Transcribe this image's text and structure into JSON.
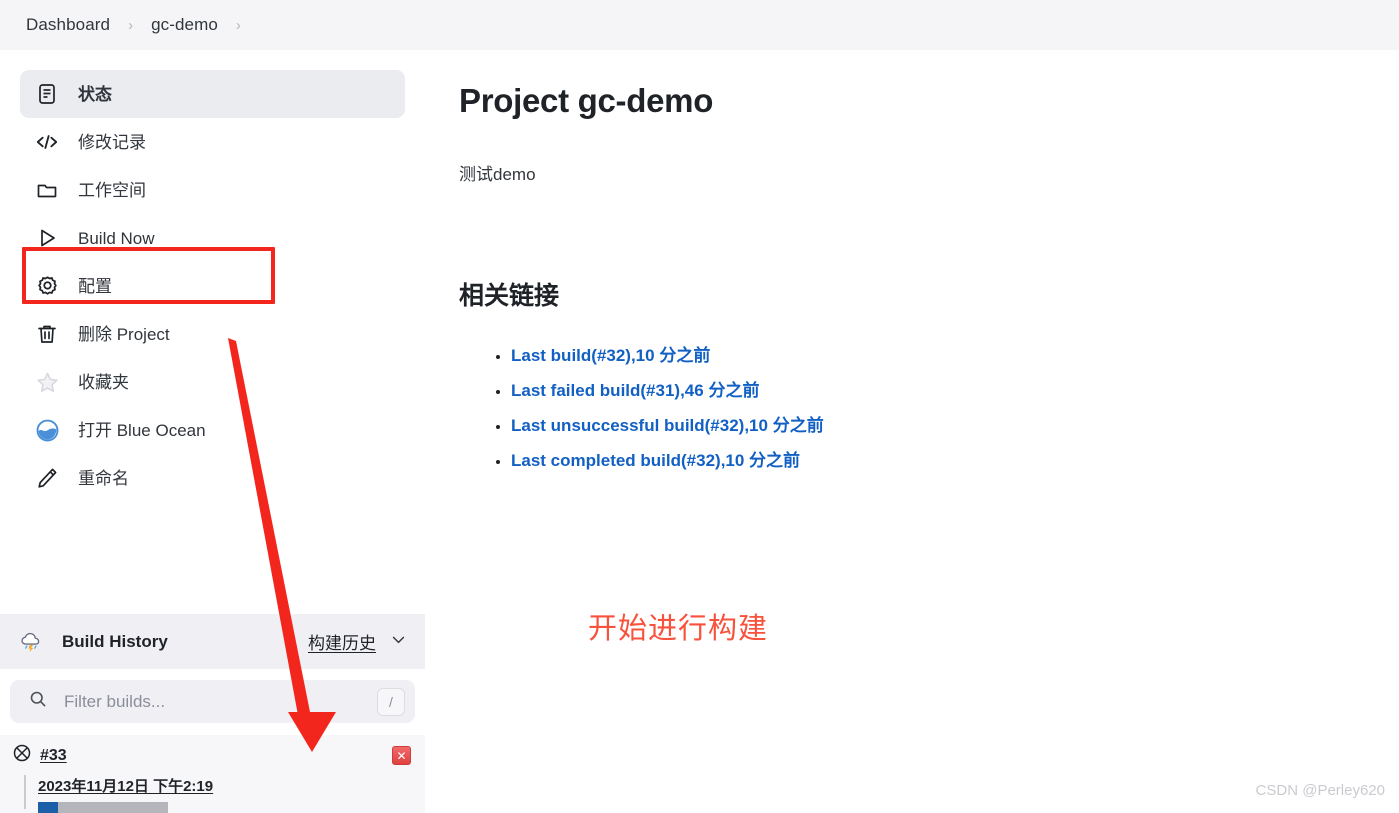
{
  "breadcrumb": {
    "items": [
      {
        "label": "Dashboard"
      },
      {
        "label": "gc-demo"
      }
    ],
    "separator": "›"
  },
  "sidebar": {
    "items": [
      {
        "label": "状态",
        "icon": "document-icon",
        "active": true
      },
      {
        "label": "修改记录",
        "icon": "code-icon",
        "active": false
      },
      {
        "label": "工作空间",
        "icon": "folder-icon",
        "active": false
      },
      {
        "label": "Build Now",
        "icon": "play-icon",
        "active": false
      },
      {
        "label": "配置",
        "icon": "gear-icon",
        "active": false
      },
      {
        "label": "删除 Project",
        "icon": "trash-icon",
        "active": false
      },
      {
        "label": "收藏夹",
        "icon": "star-icon",
        "active": false
      },
      {
        "label": "打开 Blue Ocean",
        "icon": "blue-ocean-icon",
        "active": false
      },
      {
        "label": "重命名",
        "icon": "pencil-icon",
        "active": false
      }
    ]
  },
  "build_history": {
    "title": "Build History",
    "title_cn": "构建历史",
    "weather_icon": "cloud-lightning-icon",
    "chevron_icon": "chevron-down-icon",
    "filter": {
      "placeholder": "Filter builds...",
      "value": "",
      "search_icon": "search-icon",
      "shortcut": "/"
    },
    "builds": [
      {
        "number": "#33",
        "status_icon": "aborted-icon",
        "date": "2023年11月12日 下午2:19",
        "progress_percent": 15,
        "stop_label": "✕"
      }
    ]
  },
  "main": {
    "title": "Project gc-demo",
    "description": "测试demo",
    "section_title": "相关链接",
    "links": [
      {
        "label": "Last build(#32),10 分之前"
      },
      {
        "label": "Last failed build(#31),46 分之前"
      },
      {
        "label": "Last unsuccessful build(#32),10 分之前"
      },
      {
        "label": "Last completed build(#32),10 分之前"
      }
    ]
  },
  "annotations": {
    "callout_text": "开始进行构建",
    "highlight_color": "#f3261e",
    "arrow_color": "#f3261e"
  },
  "watermark": {
    "text": "CSDN @Perley620"
  },
  "colors": {
    "accent_link": "#1260c4",
    "sidebar_active_bg": "#ebecf0",
    "breadcrumb_bg": "#f5f5f7",
    "progress_fill": "#1a5fa8",
    "annotation_red": "#f8513c"
  }
}
